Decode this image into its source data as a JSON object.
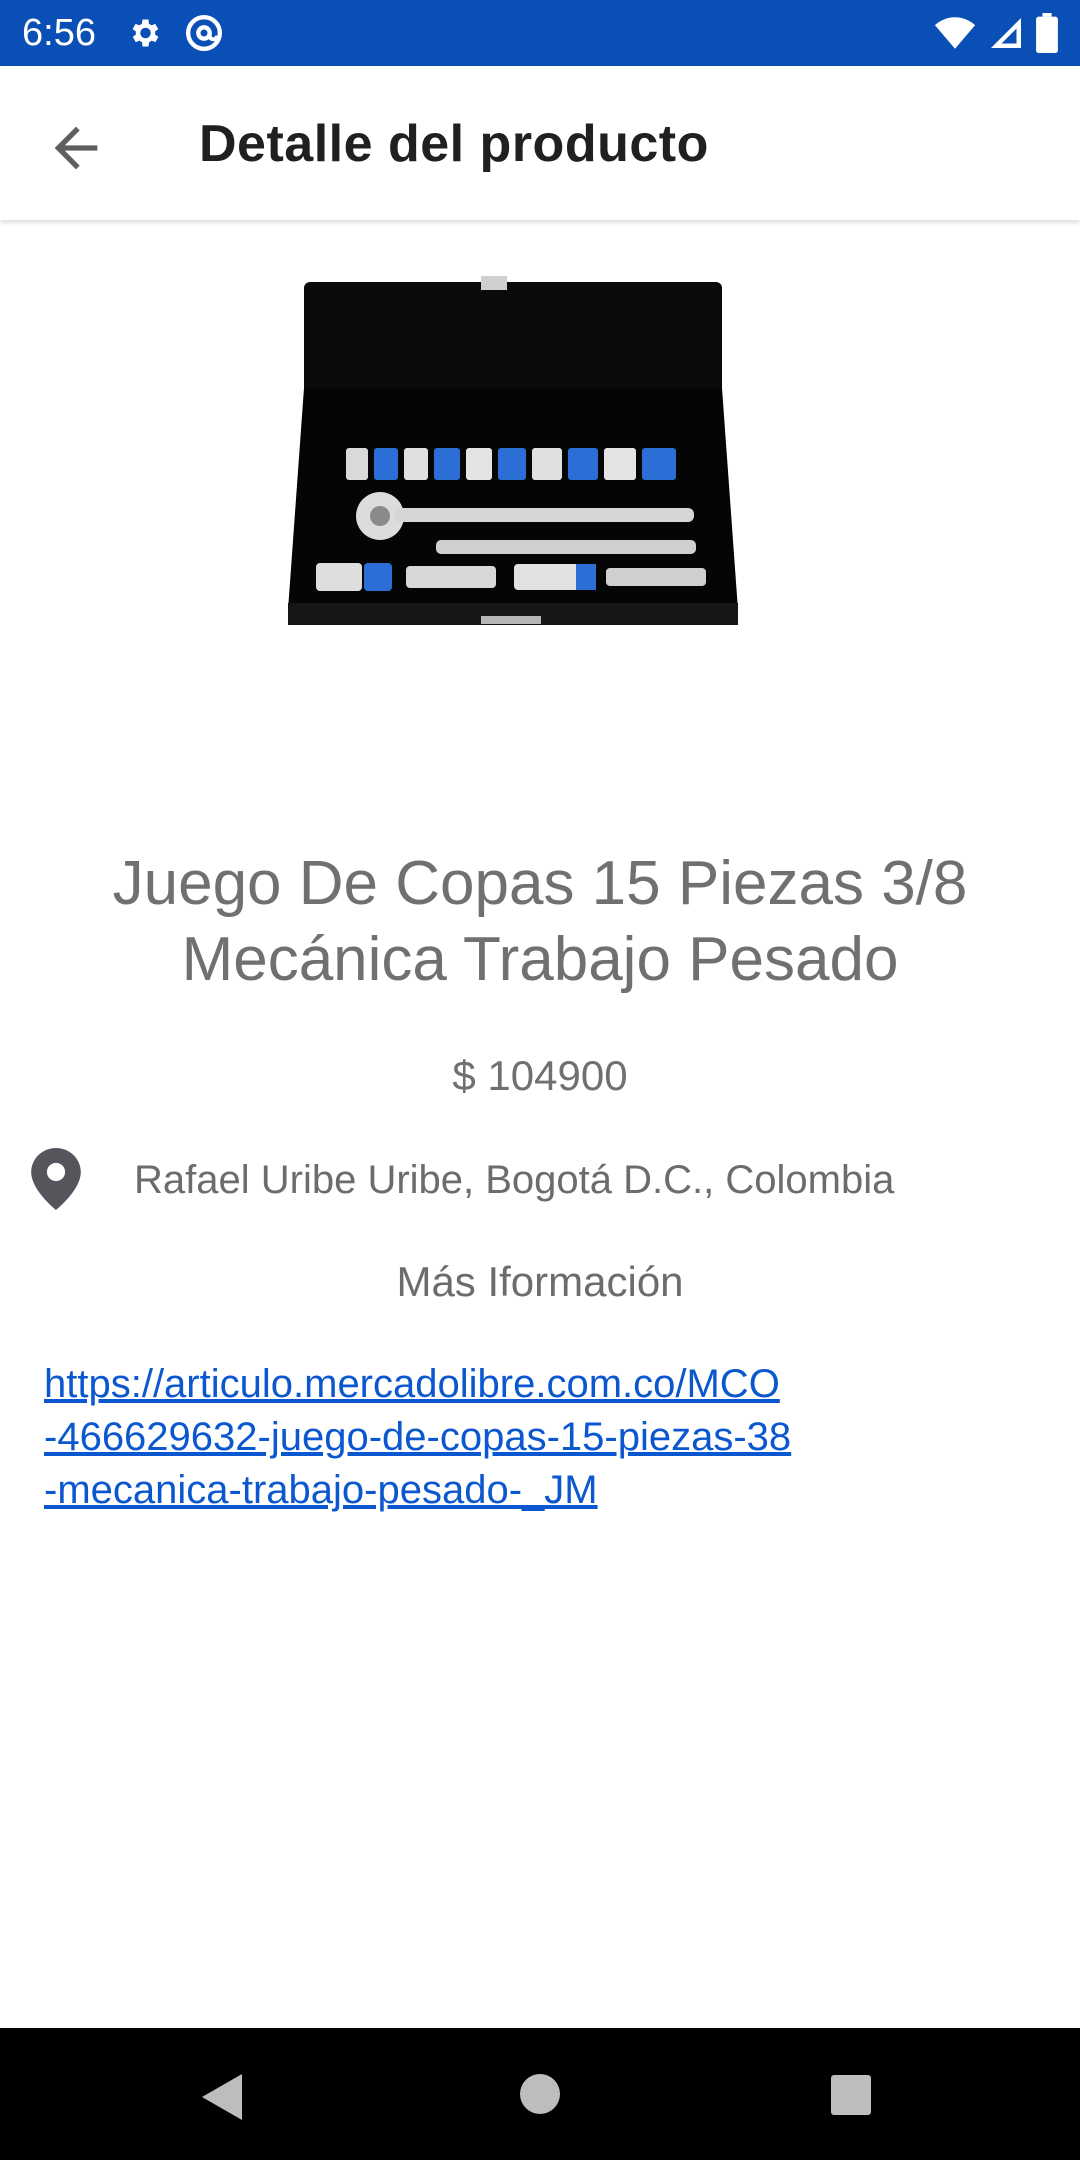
{
  "status_bar": {
    "time": "6:56",
    "icons_left": [
      "gear-icon",
      "at-sign-icon"
    ],
    "icons_right": [
      "wifi-icon",
      "signal-icon",
      "battery-icon"
    ],
    "background": "#0a4fb5"
  },
  "app_bar": {
    "title": "Detalle del producto",
    "back_icon": "arrow-left-icon"
  },
  "product": {
    "title": "Juego De Copas 15 Piezas 3/8 Mecánica Trabajo Pesado",
    "price": "$ 104900",
    "location": "Rafael Uribe Uribe, Bogotá D.C., Colombia",
    "more_info_label": "Más Iformación",
    "link": "https://articulo.mercadolibre.com.co/MCO\n-466629632-juego-de-copas-15-piezas-38\n-mecanica-trabajo-pesado-_JM",
    "location_icon": "map-pin-icon"
  },
  "nav_bar": {
    "icons": [
      "nav-back-icon",
      "nav-home-icon",
      "nav-recents-icon"
    ]
  },
  "colors": {
    "accent": "#0a4fb5",
    "link": "#0b57d0"
  }
}
